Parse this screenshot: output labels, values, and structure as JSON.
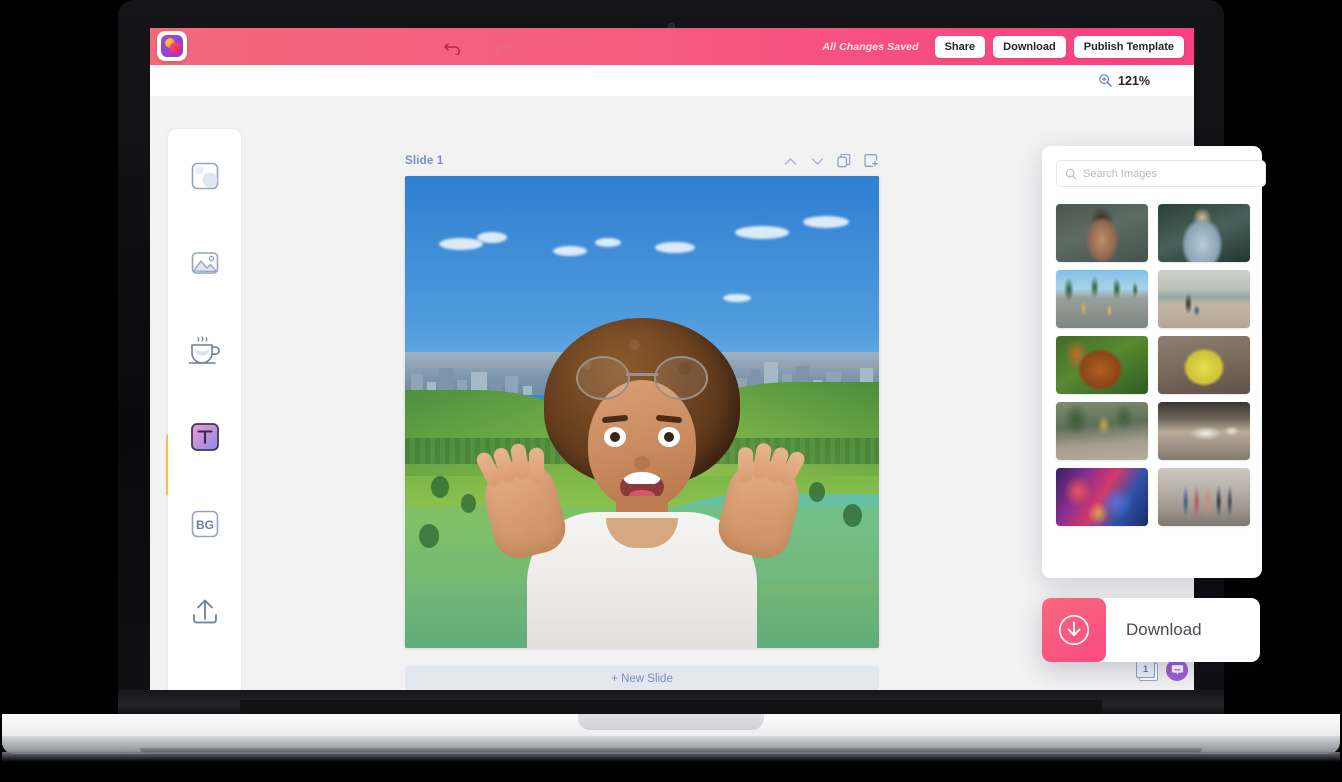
{
  "app": {
    "logo_icon": "app-logo-icon",
    "header": {
      "undo_icon": "undo-icon",
      "redo_icon": "redo-icon",
      "saved_status": "All Changes Saved",
      "share_label": "Share",
      "download_label": "Download",
      "publish_label": "Publish Template"
    },
    "zoom": {
      "icon": "zoom-in-icon",
      "value": "121%"
    }
  },
  "sidebar": {
    "items": [
      {
        "name": "templates",
        "icon": "shapes-icon",
        "active": false
      },
      {
        "name": "images",
        "icon": "image-icon",
        "active": false
      },
      {
        "name": "stickers",
        "icon": "coffee-cup-icon",
        "active": false
      },
      {
        "name": "text",
        "icon": "text-t-icon",
        "label": "T",
        "active": true
      },
      {
        "name": "background",
        "icon": "bg-icon",
        "label": "BG",
        "active": false
      },
      {
        "name": "upload",
        "icon": "upload-icon",
        "active": false
      }
    ]
  },
  "slide": {
    "title": "Slide 1",
    "actions": [
      {
        "name": "move-up",
        "icon": "chevron-up-icon"
      },
      {
        "name": "move-down",
        "icon": "chevron-down-icon"
      },
      {
        "name": "duplicate-slide",
        "icon": "duplicate-icon"
      },
      {
        "name": "add-slide",
        "icon": "add-frame-icon"
      }
    ],
    "new_slide_label": "+ New Slide",
    "canvas_description": "Excited woman with afro hair and round glasses raising hands, composited over a city skyline with river and green parkland"
  },
  "images_panel": {
    "search_placeholder": "Search Images",
    "search_icon": "search-icon",
    "thumbnails": [
      {
        "id": 1,
        "alt": "woman in front of grey wall"
      },
      {
        "id": 2,
        "alt": "smiling man with sunglasses"
      },
      {
        "id": 3,
        "alt": "skateboarders on palm-lined street"
      },
      {
        "id": 4,
        "alt": "person with stroller on beach"
      },
      {
        "id": 5,
        "alt": "red squirrel on grass"
      },
      {
        "id": 6,
        "alt": "yellow duckling"
      },
      {
        "id": 7,
        "alt": "street scene with trees and shopfront"
      },
      {
        "id": 8,
        "alt": "open-plan office interior"
      },
      {
        "id": 9,
        "alt": "crowd with colorful smoke at festival"
      },
      {
        "id": 10,
        "alt": "group of women in fitness studio"
      }
    ]
  },
  "download_card": {
    "label": "Download",
    "icon": "download-circle-icon"
  },
  "floating_badges": {
    "slide_count": "1",
    "slide_count_icon": "slides-stack-icon",
    "chat_icon": "chat-bubble-icon"
  },
  "colors": {
    "header_gradient_start": "#f4687b",
    "header_gradient_end": "#f93f80",
    "accent_yellow": "#f7c948",
    "workspace_bg": "#f2f2f3",
    "slide_title": "#7a8cc4",
    "download_icon_start": "#f7697f",
    "download_icon_end": "#f94a7f",
    "chat_purple": "#9b5fd6"
  }
}
